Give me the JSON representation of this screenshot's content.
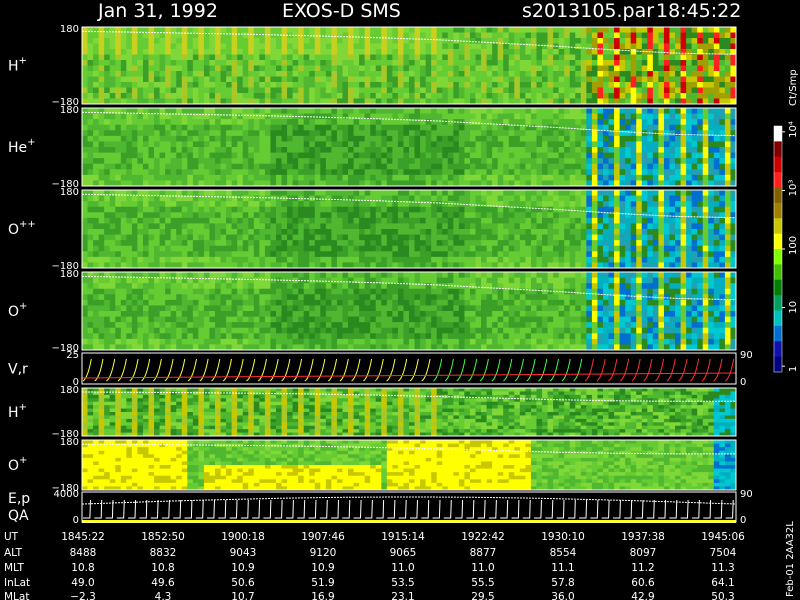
{
  "header": {
    "date": "Jan 31, 1992",
    "instrument": "EXOS-D SMS",
    "file": "s2013105.par",
    "time": "18:45:22"
  },
  "colors": {
    "background": "#000000",
    "text": "#ffffff",
    "trace": "#ffffff",
    "vr_curve_a": "#ffff40",
    "vr_curve_b": "#40ff40",
    "vr_curve_c": "#ff3030"
  },
  "chart_data": [
    {
      "type": "heatmap",
      "panel": "H+",
      "label": "H",
      "label_sup": "+",
      "y_top": "180",
      "y_bottom": "−180",
      "ylim": [
        -180,
        180
      ],
      "trend": [
        160,
        155,
        150,
        145,
        138,
        130,
        120,
        105,
        90,
        72,
        58,
        52
      ]
    },
    {
      "type": "heatmap",
      "panel": "He+",
      "label": "He",
      "label_sup": "+",
      "y_top": "180",
      "y_bottom": "−180",
      "ylim": [
        -180,
        180
      ],
      "trend": [
        160,
        155,
        150,
        145,
        138,
        130,
        120,
        105,
        90,
        72,
        58,
        52
      ]
    },
    {
      "type": "heatmap",
      "panel": "O++",
      "label": "O",
      "label_sup": "++",
      "y_top": "180",
      "y_bottom": "−180",
      "ylim": [
        -180,
        180
      ],
      "trend": [
        160,
        155,
        150,
        145,
        138,
        130,
        120,
        105,
        90,
        72,
        58,
        52
      ]
    },
    {
      "type": "heatmap",
      "panel": "O+",
      "label": "O",
      "label_sup": "+",
      "y_top": "180",
      "y_bottom": "−180",
      "ylim": [
        -180,
        180
      ],
      "trend": [
        160,
        155,
        150,
        145,
        138,
        130,
        120,
        105,
        90,
        72,
        58,
        52
      ]
    },
    {
      "type": "line",
      "panel": "V,r",
      "label": "V,r",
      "y_top": "25",
      "y_bottom": "0",
      "y_right_top": "90",
      "y_right_bottom": "0",
      "ylim": [
        0,
        25
      ]
    },
    {
      "type": "heatmap",
      "panel": "H+ (lower)",
      "label": "H",
      "label_sup": "+",
      "y_top": "180",
      "y_bottom": "−180",
      "ylim": [
        -180,
        180
      ],
      "trend": [
        150,
        148,
        144,
        140,
        134,
        126,
        116,
        104,
        92,
        84,
        80,
        80
      ]
    },
    {
      "type": "heatmap",
      "panel": "O+ (lower)",
      "label": "O",
      "label_sup": "+",
      "y_top": "180",
      "y_bottom": "−180",
      "ylim": [
        -180,
        180
      ],
      "trend": [
        150,
        148,
        144,
        140,
        134,
        126,
        116,
        104,
        92,
        84,
        80,
        80
      ]
    },
    {
      "type": "line",
      "panel": "E,p QA",
      "label": "E,p",
      "label2": "QA",
      "y_top": "4000",
      "y_bottom": "0",
      "y_right_top": "90",
      "y_right_bottom": "0",
      "ylim": [
        0,
        4000
      ]
    },
    {
      "type": "table",
      "rows": [
        {
          "label": "UT",
          "values": [
            "1845:22",
            "1852:50",
            "1900:18",
            "1907:46",
            "1915:14",
            "1922:42",
            "1930:10",
            "1937:38",
            "1945:06"
          ]
        },
        {
          "label": "ALT",
          "values": [
            "8488",
            "8832",
            "9043",
            "9120",
            "9065",
            "8877",
            "8554",
            "8097",
            "7504"
          ]
        },
        {
          "label": "MLT",
          "values": [
            "10.8",
            "10.8",
            "10.9",
            "10.9",
            "11.0",
            "11.0",
            "11.1",
            "11.2",
            "11.3"
          ]
        },
        {
          "label": "InLat",
          "values": [
            "49.0",
            "49.6",
            "50.6",
            "51.9",
            "53.5",
            "55.5",
            "57.8",
            "60.6",
            "64.1"
          ]
        },
        {
          "label": "MLat",
          "values": [
            "−2.3",
            "4.3",
            "10.7",
            "16.9",
            "23.1",
            "29.5",
            "36.0",
            "42.9",
            "50.3"
          ]
        }
      ]
    },
    {
      "type": "heatmap",
      "role": "colorbar",
      "unit": "Ct/Smp",
      "tick_labels": [
        "10⁴",
        "10³",
        "100",
        "10",
        "1"
      ],
      "tick_log": [
        4,
        3,
        2,
        1,
        0
      ],
      "lim_log": [
        -0.1,
        4.1
      ],
      "palette": [
        "#ffffff",
        "#800000",
        "#cc0000",
        "#ff2020",
        "#806000",
        "#a08000",
        "#c8c800",
        "#ffff00",
        "#80ff00",
        "#40c000",
        "#008000",
        "#00a060",
        "#00c0c0",
        "#0070d0",
        "#1010b0",
        "#000080"
      ]
    },
    {
      "type": "table",
      "role": "footer-id",
      "text": "Feb-01 2AA32L"
    }
  ]
}
